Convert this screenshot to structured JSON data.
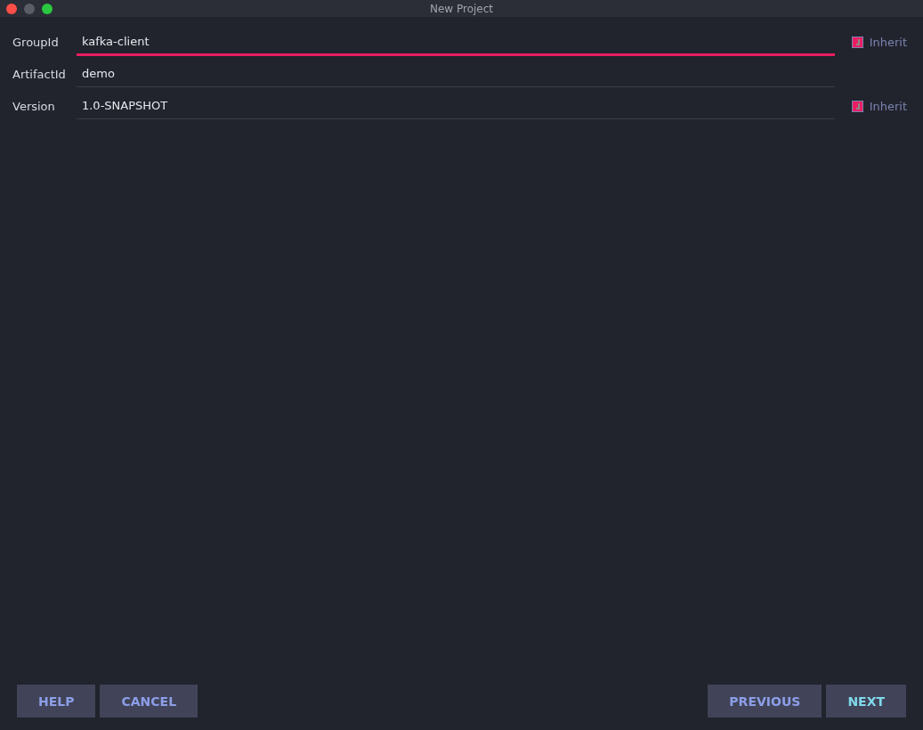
{
  "window": {
    "title": "New Project"
  },
  "fields": [
    {
      "label": "GroupId",
      "value": "kafka-client",
      "focused": true,
      "inherit": {
        "label": "Inherit",
        "checked": true
      }
    },
    {
      "label": "ArtifactId",
      "value": "demo",
      "focused": false
    },
    {
      "label": "Version",
      "value": "1.0-SNAPSHOT",
      "focused": false,
      "inherit": {
        "label": "Inherit",
        "checked": true
      }
    }
  ],
  "buttons_left": [
    {
      "label": "HELP",
      "default": false
    },
    {
      "label": "CANCEL",
      "default": false
    }
  ],
  "buttons_right": [
    {
      "label": "PREVIOUS",
      "default": false
    },
    {
      "label": "NEXT",
      "default": true
    }
  ]
}
